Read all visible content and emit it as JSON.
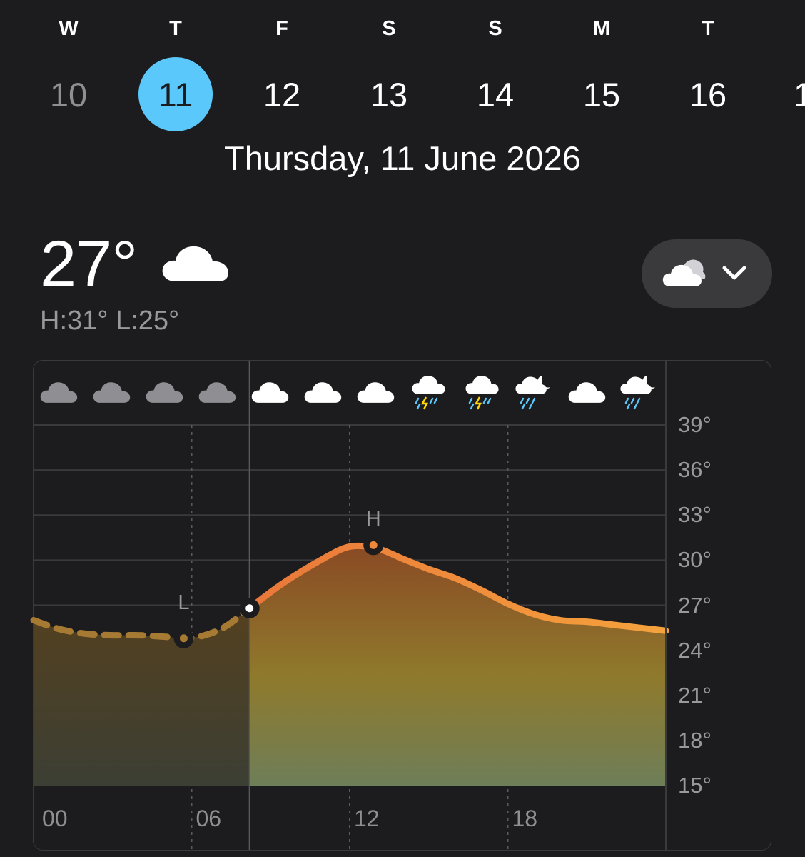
{
  "week": {
    "letters": [
      "W",
      "T",
      "F",
      "S",
      "S",
      "M",
      "T"
    ],
    "numbers": [
      "10",
      "11",
      "12",
      "13",
      "14",
      "15",
      "16",
      "1"
    ],
    "selected_index": 1
  },
  "date_title": "Thursday, 11 June 2026",
  "current": {
    "temp": "27°",
    "hi_lo": "H:31° L:25°",
    "icon": "cloud-icon"
  },
  "selector": {
    "icon": "partly-cloudy-icon",
    "chevron": "chevron-down-icon"
  },
  "colors": {
    "background": "#1c1c1e",
    "selected_day": "#5ac8fa",
    "line_orange": "#f0883a",
    "line_yellow": "#f5a23d",
    "past_line": "#a67a32",
    "grid": "#3a3a3c",
    "label_gray": "#98989d"
  },
  "chart_data": {
    "type": "area",
    "x_ticks": [
      "00",
      "06",
      "12",
      "18"
    ],
    "y_ticks": [
      "39°",
      "36°",
      "33°",
      "30°",
      "27°",
      "24°",
      "21°",
      "18°",
      "15°"
    ],
    "ylim": [
      15,
      39
    ],
    "xlim": [
      0,
      24
    ],
    "now_hour": 8.2,
    "x": [
      0,
      1,
      2,
      3,
      4,
      5,
      5.7,
      6.5,
      7.3,
      8.2,
      9.5,
      11,
      12,
      13,
      14,
      15,
      16,
      17,
      18,
      19,
      20,
      21,
      22,
      23,
      24
    ],
    "y": [
      26,
      25.4,
      25.1,
      25,
      25,
      24.9,
      24.8,
      25,
      25.6,
      26.8,
      28.5,
      30.1,
      30.9,
      30.8,
      30.1,
      29.4,
      28.8,
      28,
      27.1,
      26.4,
      26,
      25.9,
      25.7,
      25.5,
      25.3
    ],
    "low": {
      "label": "L",
      "hour": 5.7,
      "value": 24.8
    },
    "high": {
      "label": "H",
      "hour": 12.9,
      "value": 31
    },
    "hourly_icons": [
      "cloud-icon",
      "cloud-icon",
      "cloud-icon",
      "cloud-icon",
      "cloud-icon",
      "cloud-icon",
      "cloud-icon",
      "thunderstorm-rain-icon",
      "thunderstorm-rain-icon",
      "moon-cloud-rain-icon",
      "cloud-icon",
      "moon-cloud-rain-icon"
    ],
    "past_icon_count": 4
  }
}
